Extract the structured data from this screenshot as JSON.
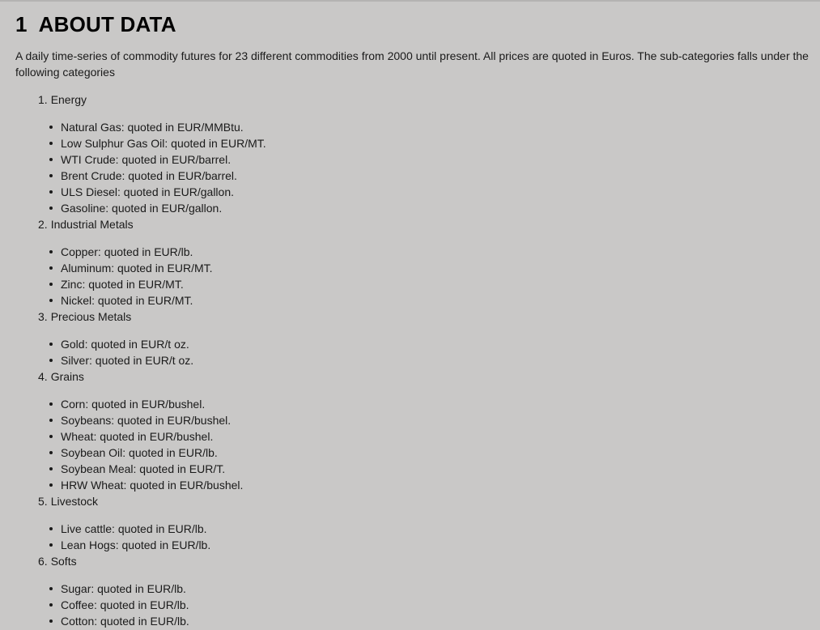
{
  "heading": {
    "number": "1",
    "title": "ABOUT DATA"
  },
  "intro": "A daily time-series of commodity futures for 23 different commodities from 2000 until present. All prices are quoted in Euros. The sub-categories falls under the following categories",
  "categories": [
    {
      "index": "1.",
      "name": "Energy",
      "items": [
        "Natural Gas: quoted in EUR/MMBtu.",
        "Low Sulphur Gas Oil: quoted in EUR/MT.",
        "WTI Crude: quoted in EUR/barrel.",
        "Brent Crude: quoted in EUR/barrel.",
        "ULS Diesel: quoted in EUR/gallon.",
        "Gasoline: quoted in EUR/gallon."
      ]
    },
    {
      "index": "2.",
      "name": "Industrial Metals",
      "items": [
        "Copper: quoted in EUR/lb.",
        "Aluminum: quoted in EUR/MT.",
        "Zinc: quoted in EUR/MT.",
        "Nickel: quoted in EUR/MT."
      ]
    },
    {
      "index": "3.",
      "name": "Precious Metals",
      "items": [
        "Gold: quoted in EUR/t oz.",
        "Silver: quoted in EUR/t oz."
      ]
    },
    {
      "index": "4.",
      "name": "Grains",
      "items": [
        "Corn: quoted in EUR/bushel.",
        "Soybeans: quoted in EUR/bushel.",
        "Wheat: quoted in EUR/bushel.",
        "Soybean Oil: quoted in EUR/lb.",
        "Soybean Meal: quoted in EUR/T.",
        "HRW Wheat: quoted in EUR/bushel."
      ]
    },
    {
      "index": "5.",
      "name": "Livestock",
      "items": [
        "Live cattle: quoted in EUR/lb.",
        "Lean Hogs: quoted in EUR/lb."
      ]
    },
    {
      "index": "6.",
      "name": "Softs",
      "items": [
        "Sugar: quoted in EUR/lb.",
        "Coffee: quoted in EUR/lb.",
        "Cotton: quoted in EUR/lb."
      ]
    }
  ]
}
